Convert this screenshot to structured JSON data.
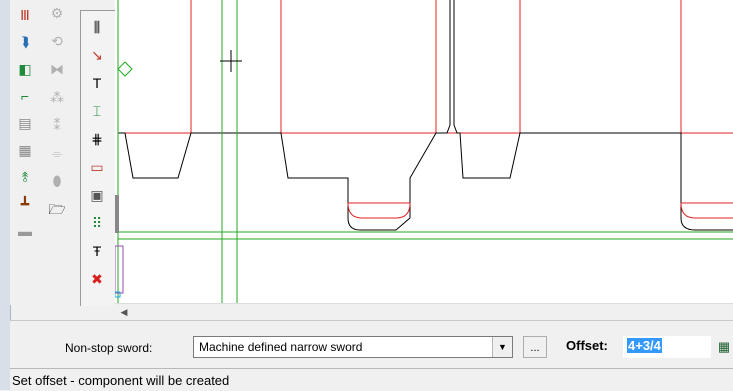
{
  "toolbar": {
    "col1": [
      {
        "name": "rule-lines-tool-icon",
        "glyph": "Ⅲ",
        "color": "#c0392b"
      },
      {
        "name": "split-arrow-tool-icon",
        "glyph": "⮯",
        "color": "#2a6fb5"
      },
      {
        "name": "component-insert-tool-icon",
        "glyph": "◧",
        "color": "#1e8a3a"
      },
      {
        "name": "flap-tool-icon",
        "glyph": "⌐",
        "color": "#1e8a3a"
      },
      {
        "name": "panel-tool-icon",
        "glyph": "▤",
        "color": "#888888"
      },
      {
        "name": "grid-panel-tool-icon",
        "glyph": "▦",
        "color": "#888888"
      },
      {
        "name": "tree-branch-tool-icon",
        "glyph": "⥉",
        "color": "#1e8a3a"
      },
      {
        "name": "bridge-tool-icon",
        "glyph": "┻",
        "color": "#8a3a00"
      },
      {
        "name": "layers-tool-icon",
        "glyph": "▬",
        "color": "#999999"
      }
    ],
    "col2": [
      {
        "name": "gear-tool-icon",
        "glyph": "⚙",
        "dim": true
      },
      {
        "name": "rotate-tool-icon",
        "glyph": "⟲",
        "dim": true
      },
      {
        "name": "mirror-tool-icon",
        "glyph": "⧓",
        "dim": true
      },
      {
        "name": "pattern-tool-icon",
        "glyph": "⁂",
        "dim": true
      },
      {
        "name": "copy-pattern-tool-icon",
        "glyph": "⁑",
        "dim": true
      },
      {
        "name": "hook-tool-icon",
        "glyph": "⌯",
        "dim": true
      },
      {
        "name": "blob-shape-tool-icon",
        "glyph": "⬮",
        "dim": true
      },
      {
        "name": "open-folder-tool-icon",
        "glyph": "🗁",
        "dim": false
      }
    ],
    "col3": [
      {
        "name": "nick-tool-icon",
        "glyph": "⫼",
        "color": "#000000"
      },
      {
        "name": "sword-insert-tool-icon",
        "glyph": "↘",
        "color": "#c0392b"
      },
      {
        "name": "t-bar-tool-icon",
        "glyph": "T",
        "color": "#000000"
      },
      {
        "name": "bracket-tool-icon",
        "glyph": "⌶",
        "color": "#1e8a3a"
      },
      {
        "name": "bridge-cut-tool-icon",
        "glyph": "⋕",
        "color": "#000000"
      },
      {
        "name": "eraser-tool-icon",
        "glyph": "▭",
        "color": "#c0392b"
      },
      {
        "name": "window-tool-icon",
        "glyph": "▣",
        "color": "#555555"
      },
      {
        "name": "dotted-grid-tool-icon",
        "glyph": "⠿",
        "color": "#1e8a3a"
      },
      {
        "name": "text-underline-tool-icon",
        "glyph": "Ŧ",
        "color": "#000000"
      },
      {
        "name": "delete-tool-icon",
        "glyph": "✖",
        "color": "#d61f1f"
      }
    ]
  },
  "options": {
    "sword_label": "Non-stop sword:",
    "sword_value": "Machine defined narrow sword",
    "ellipsis": "...",
    "offset_label": "Offset:",
    "offset_value": "4+3/4"
  },
  "status": {
    "text": "Set offset - component will be created"
  },
  "colors": {
    "red_line": "#e02020",
    "black_line": "#000000",
    "green_line": "#22aa22",
    "selection": "#3399ff"
  },
  "icons": {
    "scroll_left": "◀",
    "dropdown": "▼",
    "calculator": "▦"
  }
}
